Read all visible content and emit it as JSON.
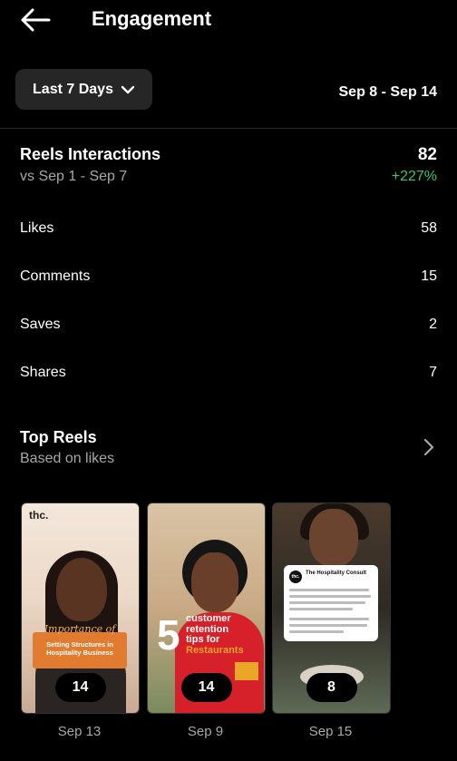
{
  "header": {
    "title": "Engagement"
  },
  "filter": {
    "range_label": "Last 7 Days",
    "date_range": "Sep 8 - Sep 14"
  },
  "reels_interactions": {
    "title": "Reels Interactions",
    "comparison": "vs Sep 1 - Sep 7",
    "total": "82",
    "change": "+227%",
    "change_color": "#3ec46d",
    "metrics": [
      {
        "label": "Likes",
        "value": "58"
      },
      {
        "label": "Comments",
        "value": "15"
      },
      {
        "label": "Saves",
        "value": "2"
      },
      {
        "label": "Shares",
        "value": "7"
      }
    ]
  },
  "top_reels": {
    "title": "Top Reels",
    "subtitle": "Based on likes",
    "items": [
      {
        "count": "14",
        "date": "Sep 13",
        "logo": "thc.",
        "script": "Importance of",
        "caption": "Setting Structures in Hospitality Business"
      },
      {
        "count": "14",
        "date": "Sep 9",
        "number": "5",
        "tips": [
          "customer",
          "retention",
          "tips for"
        ],
        "highlight": "Restaurants"
      },
      {
        "count": "8",
        "date": "Sep 15",
        "card_name": "The Hospitality Consult",
        "card_avatar": "thc."
      }
    ]
  },
  "icons": {
    "back": "arrow-left-icon",
    "dropdown": "chevron-down-icon",
    "more": "chevron-right-icon"
  }
}
